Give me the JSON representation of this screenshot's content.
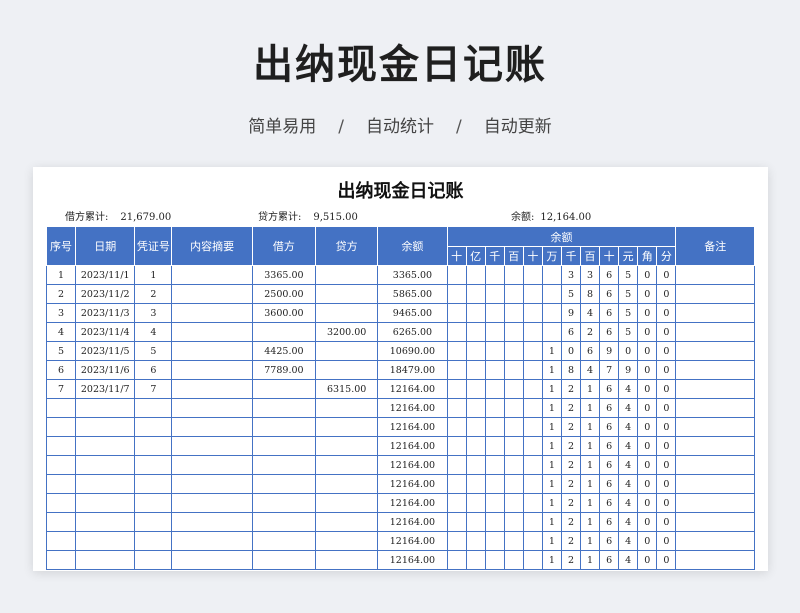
{
  "hero": {
    "title": "出纳现金日记账",
    "tags": [
      "简单易用",
      "自动统计",
      "自动更新"
    ],
    "separator": "/"
  },
  "document": {
    "title": "出纳现金日记账",
    "summary": {
      "debit_label": "借方累计:",
      "debit_value": "21,679.00",
      "credit_label": "贷方累计:",
      "credit_value": "9,515.00",
      "balance_label": "余额:",
      "balance_value": "12,164.00"
    }
  },
  "table": {
    "headers": {
      "seq": "序号",
      "date": "日期",
      "voucher": "凭证号",
      "desc": "内容摘要",
      "debit": "借方",
      "credit": "贷方",
      "balance": "余额",
      "balance_group": "余额",
      "notes": "备注"
    },
    "digit_headers": [
      "十",
      "亿",
      "千",
      "百",
      "十",
      "万",
      "千",
      "百",
      "十",
      "元",
      "角",
      "分"
    ],
    "rows": [
      {
        "seq": "1",
        "date": "2023/11/1",
        "voucher": "1",
        "desc": "",
        "debit": "3365.00",
        "credit": "",
        "balance": "3365.00",
        "digits": [
          "",
          "",
          "",
          "",
          "",
          "",
          "3",
          "3",
          "6",
          "5",
          "0",
          "0"
        ],
        "notes": ""
      },
      {
        "seq": "2",
        "date": "2023/11/2",
        "voucher": "2",
        "desc": "",
        "debit": "2500.00",
        "credit": "",
        "balance": "5865.00",
        "digits": [
          "",
          "",
          "",
          "",
          "",
          "",
          "5",
          "8",
          "6",
          "5",
          "0",
          "0"
        ],
        "notes": ""
      },
      {
        "seq": "3",
        "date": "2023/11/3",
        "voucher": "3",
        "desc": "",
        "debit": "3600.00",
        "credit": "",
        "balance": "9465.00",
        "digits": [
          "",
          "",
          "",
          "",
          "",
          "",
          "9",
          "4",
          "6",
          "5",
          "0",
          "0"
        ],
        "notes": ""
      },
      {
        "seq": "4",
        "date": "2023/11/4",
        "voucher": "4",
        "desc": "",
        "debit": "",
        "credit": "3200.00",
        "balance": "6265.00",
        "digits": [
          "",
          "",
          "",
          "",
          "",
          "",
          "6",
          "2",
          "6",
          "5",
          "0",
          "0"
        ],
        "notes": ""
      },
      {
        "seq": "5",
        "date": "2023/11/5",
        "voucher": "5",
        "desc": "",
        "debit": "4425.00",
        "credit": "",
        "balance": "10690.00",
        "digits": [
          "",
          "",
          "",
          "",
          "",
          "1",
          "0",
          "6",
          "9",
          "0",
          "0",
          "0"
        ],
        "notes": ""
      },
      {
        "seq": "6",
        "date": "2023/11/6",
        "voucher": "6",
        "desc": "",
        "debit": "7789.00",
        "credit": "",
        "balance": "18479.00",
        "digits": [
          "",
          "",
          "",
          "",
          "",
          "1",
          "8",
          "4",
          "7",
          "9",
          "0",
          "0"
        ],
        "notes": ""
      },
      {
        "seq": "7",
        "date": "2023/11/7",
        "voucher": "7",
        "desc": "",
        "debit": "",
        "credit": "6315.00",
        "balance": "12164.00",
        "digits": [
          "",
          "",
          "",
          "",
          "",
          "1",
          "2",
          "1",
          "6",
          "4",
          "0",
          "0"
        ],
        "notes": ""
      },
      {
        "seq": "",
        "date": "",
        "voucher": "",
        "desc": "",
        "debit": "",
        "credit": "",
        "balance": "12164.00",
        "digits": [
          "",
          "",
          "",
          "",
          "",
          "1",
          "2",
          "1",
          "6",
          "4",
          "0",
          "0"
        ],
        "notes": ""
      },
      {
        "seq": "",
        "date": "",
        "voucher": "",
        "desc": "",
        "debit": "",
        "credit": "",
        "balance": "12164.00",
        "digits": [
          "",
          "",
          "",
          "",
          "",
          "1",
          "2",
          "1",
          "6",
          "4",
          "0",
          "0"
        ],
        "notes": ""
      },
      {
        "seq": "",
        "date": "",
        "voucher": "",
        "desc": "",
        "debit": "",
        "credit": "",
        "balance": "12164.00",
        "digits": [
          "",
          "",
          "",
          "",
          "",
          "1",
          "2",
          "1",
          "6",
          "4",
          "0",
          "0"
        ],
        "notes": ""
      },
      {
        "seq": "",
        "date": "",
        "voucher": "",
        "desc": "",
        "debit": "",
        "credit": "",
        "balance": "12164.00",
        "digits": [
          "",
          "",
          "",
          "",
          "",
          "1",
          "2",
          "1",
          "6",
          "4",
          "0",
          "0"
        ],
        "notes": ""
      },
      {
        "seq": "",
        "date": "",
        "voucher": "",
        "desc": "",
        "debit": "",
        "credit": "",
        "balance": "12164.00",
        "digits": [
          "",
          "",
          "",
          "",
          "",
          "1",
          "2",
          "1",
          "6",
          "4",
          "0",
          "0"
        ],
        "notes": ""
      },
      {
        "seq": "",
        "date": "",
        "voucher": "",
        "desc": "",
        "debit": "",
        "credit": "",
        "balance": "12164.00",
        "digits": [
          "",
          "",
          "",
          "",
          "",
          "1",
          "2",
          "1",
          "6",
          "4",
          "0",
          "0"
        ],
        "notes": ""
      },
      {
        "seq": "",
        "date": "",
        "voucher": "",
        "desc": "",
        "debit": "",
        "credit": "",
        "balance": "12164.00",
        "digits": [
          "",
          "",
          "",
          "",
          "",
          "1",
          "2",
          "1",
          "6",
          "4",
          "0",
          "0"
        ],
        "notes": ""
      },
      {
        "seq": "",
        "date": "",
        "voucher": "",
        "desc": "",
        "debit": "",
        "credit": "",
        "balance": "12164.00",
        "digits": [
          "",
          "",
          "",
          "",
          "",
          "1",
          "2",
          "1",
          "6",
          "4",
          "0",
          "0"
        ],
        "notes": ""
      },
      {
        "seq": "",
        "date": "",
        "voucher": "",
        "desc": "",
        "debit": "",
        "credit": "",
        "balance": "12164.00",
        "digits": [
          "",
          "",
          "",
          "",
          "",
          "1",
          "2",
          "1",
          "6",
          "4",
          "0",
          "0"
        ],
        "notes": ""
      }
    ]
  },
  "colors": {
    "header_bg": "#4472c4",
    "border": "#4472c4",
    "page_bg": "#eef0f4"
  }
}
